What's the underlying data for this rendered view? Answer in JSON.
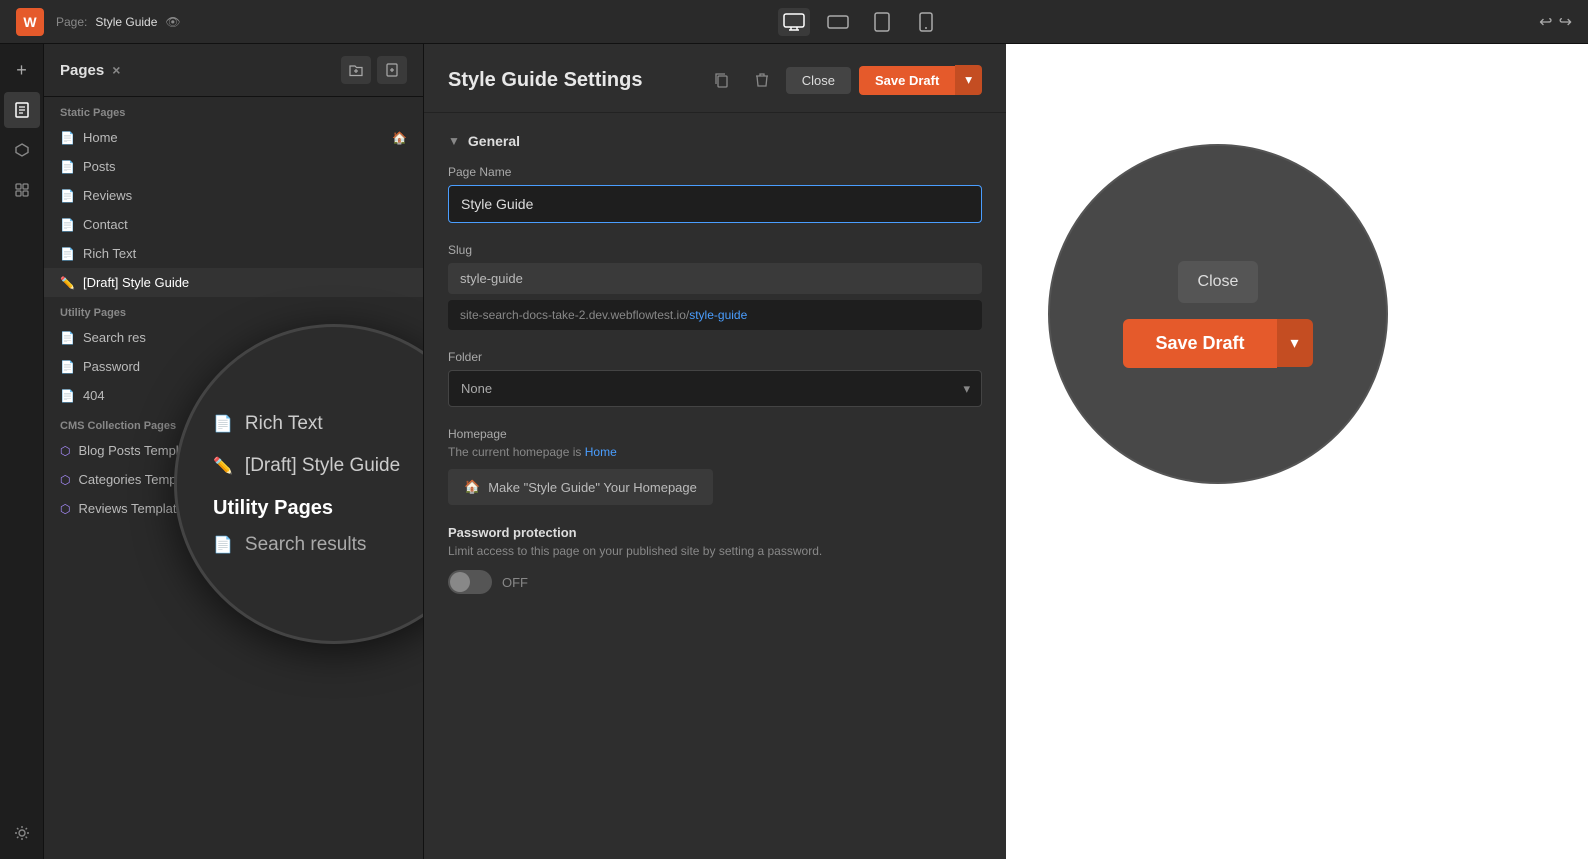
{
  "topbar": {
    "app_icon": "W",
    "page_label": "Page:",
    "page_name": "Style Guide",
    "devices": [
      {
        "id": "desktop",
        "label": "Desktop",
        "icon": "🖥",
        "active": true
      },
      {
        "id": "tablet-landscape",
        "label": "Tablet Landscape",
        "icon": "⬜",
        "active": false
      },
      {
        "id": "tablet-portrait",
        "label": "Tablet Portrait",
        "icon": "▭",
        "active": false
      },
      {
        "id": "mobile",
        "label": "Mobile",
        "icon": "📱",
        "active": false
      }
    ],
    "undo_icon": "↩",
    "redo_icon": "↪"
  },
  "icon_sidebar": {
    "buttons": [
      {
        "id": "add",
        "icon": "+",
        "active": false
      },
      {
        "id": "pages",
        "icon": "☰",
        "active": true
      },
      {
        "id": "cms",
        "icon": "⬡",
        "active": false
      },
      {
        "id": "assets",
        "icon": "◫",
        "active": false
      },
      {
        "id": "settings",
        "icon": "⚙",
        "active": false
      }
    ]
  },
  "pages_panel": {
    "title": "Pages",
    "close_label": "×",
    "action_folder_icon": "📁+",
    "action_page_icon": "📄+",
    "sections": [
      {
        "label": "Static Pages",
        "items": [
          {
            "name": "Home",
            "type": "page",
            "has_home_icon": true
          },
          {
            "name": "Posts",
            "type": "page",
            "has_home_icon": false
          },
          {
            "name": "Reviews",
            "type": "page",
            "has_home_icon": false
          },
          {
            "name": "Contact",
            "type": "page",
            "has_home_icon": false
          },
          {
            "name": "Rich Text",
            "type": "page",
            "has_home_icon": false
          },
          {
            "name": "[Draft] Style Guide",
            "type": "draft",
            "has_home_icon": false,
            "active": true
          }
        ]
      },
      {
        "label": "Utility Pages",
        "items": [
          {
            "name": "Search res",
            "type": "page",
            "has_home_icon": false
          },
          {
            "name": "Password",
            "type": "page",
            "has_home_icon": false
          },
          {
            "name": "404",
            "type": "page",
            "has_home_icon": false
          }
        ]
      },
      {
        "label": "CMS Collection Pages",
        "items": [
          {
            "name": "Blog Posts Template",
            "type": "cms",
            "has_home_icon": false
          },
          {
            "name": "Categories Template",
            "type": "cms",
            "has_home_icon": false
          },
          {
            "name": "Reviews Template",
            "type": "cms",
            "has_home_icon": false
          }
        ]
      }
    ]
  },
  "magnify": {
    "items": [
      {
        "type": "page",
        "name": "Rich Text"
      },
      {
        "type": "draft",
        "name": "[Draft] Style Guide"
      },
      {
        "type": "section",
        "name": "Utility Pages"
      },
      {
        "type": "sub",
        "name": "Search results"
      }
    ]
  },
  "settings": {
    "title": "Style Guide Settings",
    "section_general": "General",
    "field_page_name_label": "Page Name",
    "field_page_name_value": "Style Guide",
    "field_slug_label": "Slug",
    "field_slug_value": "style-guide",
    "url_prefix": "site-search-docs-take-2.dev.webflowtest.io/",
    "url_suffix": "style-guide",
    "field_folder_label": "Folder",
    "field_folder_placeholder": "None",
    "field_homepage_label": "Homepage",
    "field_homepage_desc_prefix": "The current homepage is ",
    "field_homepage_link": "Home",
    "make_homepage_btn": "Make \"Style Guide\" Your Homepage",
    "password_title": "Password protection",
    "password_desc": "Limit access to this page on your published site by setting a password.",
    "toggle_state": "OFF",
    "close_btn": "Close",
    "save_draft_btn": "Save Draft",
    "save_draft_arrow": "▾"
  },
  "big_circle": {
    "close_btn": "Close",
    "save_btn": "Save Draft",
    "arrow": "▾"
  }
}
